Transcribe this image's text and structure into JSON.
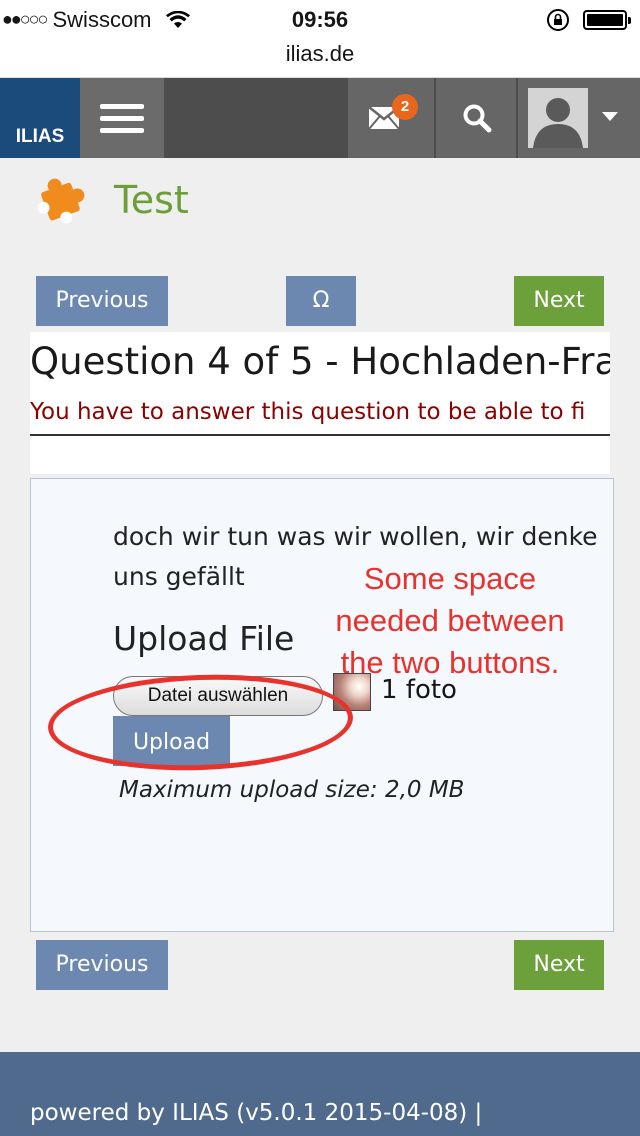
{
  "status_bar": {
    "signal_dots": "●●○○○",
    "carrier": "Swisscom",
    "time": "09:56"
  },
  "url_bar": {
    "domain": "ilias.de"
  },
  "header": {
    "logo_text": "ILIAS",
    "mail_badge_count": "2",
    "icons": [
      "menu-icon",
      "mail-icon",
      "search-icon",
      "avatar",
      "chevron-down-icon"
    ]
  },
  "page": {
    "title": "Test",
    "icon": "puzzle-icon"
  },
  "nav_top": {
    "previous_label": "Previous",
    "special_char_label": "Ω",
    "next_label": "Next"
  },
  "question": {
    "title": "Question 4 of 5 - Hochladen-Fra",
    "required_notice": "You have to answer this question to be able to fi",
    "text_line1": "doch wir tun was wir wollen, wir denke",
    "text_line2": "uns gefällt",
    "upload_heading": "Upload File",
    "choose_file_label": "Datei auswählen",
    "selected_file": "1 foto",
    "upload_button_label": "Upload",
    "max_upload_size": "Maximum upload size: 2,0 MB"
  },
  "annotation": {
    "line1": "Some space",
    "line2": "needed between",
    "line3": "the two buttons."
  },
  "nav_bottom": {
    "previous_label": "Previous",
    "next_label": "Next"
  },
  "footer": {
    "text": "powered by ILIAS (v5.0.1 2015-04-08) |"
  },
  "colors": {
    "header_bg": "#4d4d4d",
    "logo_bg": "#1a4b7a",
    "button_blue": "#6c88b0",
    "button_green": "#6ca03a",
    "title_green": "#6d9e3a",
    "warning_red": "#8b0000",
    "badge_orange": "#e9671c",
    "annotation_red": "#e8322c",
    "footer_bg": "#4f6a8c"
  }
}
